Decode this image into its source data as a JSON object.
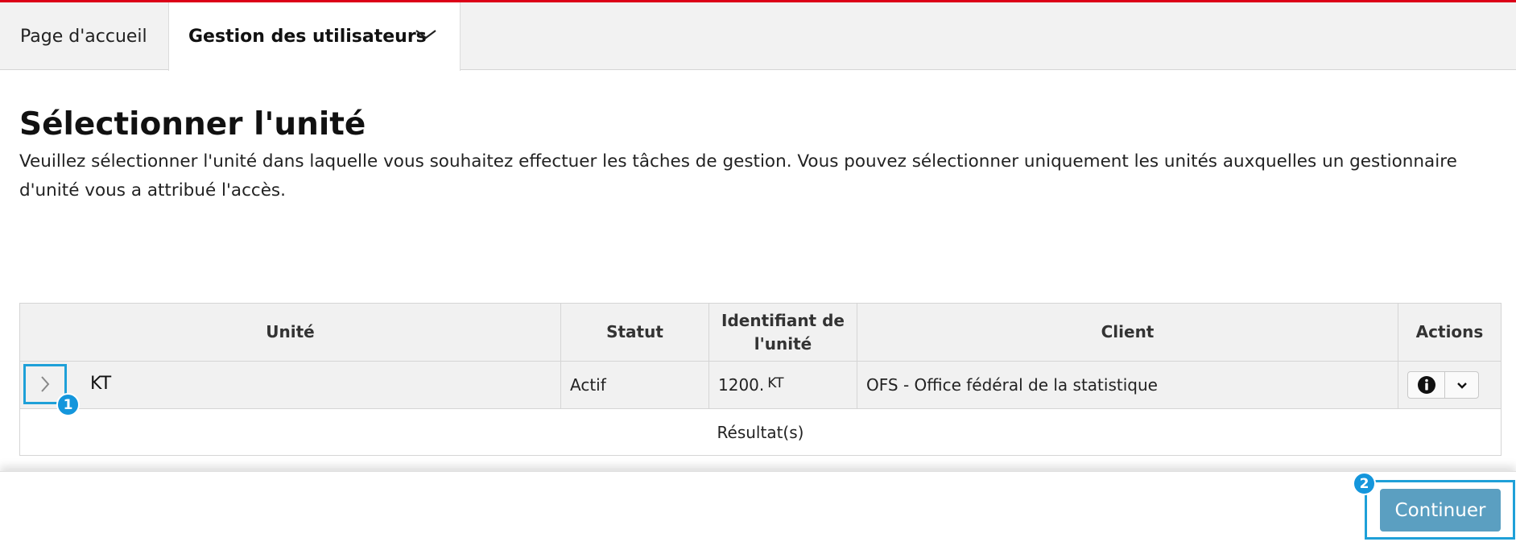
{
  "nav": {
    "home_label": "Page d'accueil",
    "users_label": "Gestion des utilisateurs"
  },
  "page": {
    "title": "Sélectionner l'unité",
    "description": "Veuillez sélectionner l'unité dans laquelle vous souhaitez effectuer les tâches de gestion. Vous pouvez sélectionner uniquement les unités auxquelles un gestionnaire d'unité vous a attribué l'accès."
  },
  "table": {
    "headers": {
      "unit": "Unité",
      "status": "Statut",
      "unit_id": "Identifiant de l'unité",
      "client": "Client",
      "actions": "Actions"
    },
    "rows": [
      {
        "unit": "KT",
        "status": "Actif",
        "unit_id_prefix": "1200.",
        "unit_id_suffix": "KT",
        "client": "OFS - Office fédéral de la statistique"
      }
    ],
    "result_label": "Résultat(s)"
  },
  "annotations": {
    "badge1": "1",
    "badge2": "2"
  },
  "footer": {
    "continue_label": "Continuer"
  },
  "colors": {
    "brand_red": "#dc0018",
    "highlight_blue": "#1ea0d8",
    "button_blue": "#5b9fc1"
  },
  "icons": {
    "nav_dropdown": "chevron-down-icon",
    "row_expand": "chevron-right-icon",
    "info": "info-circle-icon",
    "action_dropdown": "chevron-down-icon"
  }
}
